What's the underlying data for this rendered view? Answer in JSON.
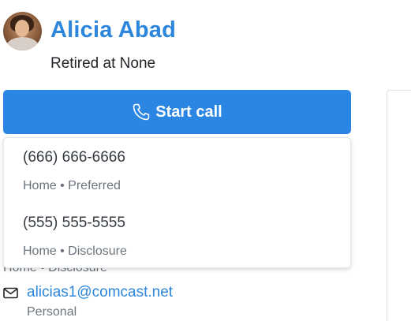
{
  "contact": {
    "name": "Alicia Abad",
    "subtitle": "Retired at None"
  },
  "call_button": {
    "label": "Start call"
  },
  "phones": [
    {
      "number": "(666) 666-6666",
      "meta": "Home • Preferred"
    },
    {
      "number": "(555) 555-5555",
      "meta": "Home • Disclosure"
    }
  ],
  "behind": {
    "phone_meta": "Home • Disclosure"
  },
  "email": {
    "address": "alicias1@comcast.net",
    "type": "Personal"
  },
  "colors": {
    "accent": "#2b86e3",
    "link": "#2b86dc",
    "muted": "#6c757d"
  },
  "icons": {
    "call": "phone-icon",
    "email": "mail-icon",
    "avatar": "avatar"
  }
}
